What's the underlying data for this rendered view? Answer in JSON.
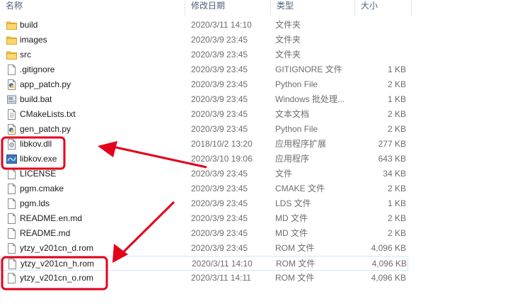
{
  "columns": {
    "name": "名称",
    "date": "修改日期",
    "type": "类型",
    "size": "大小"
  },
  "colors": {
    "annotation": "#e3001b",
    "header_text": "#4c607a",
    "meta_text": "#6d6d6d",
    "folder": "#f7c44b"
  },
  "files": [
    {
      "name": "build",
      "date": "2020/3/11 14:10",
      "type": "文件夹",
      "size": "",
      "icon": "folder-icon"
    },
    {
      "name": "images",
      "date": "2020/3/9 23:45",
      "type": "文件夹",
      "size": "",
      "icon": "folder-icon"
    },
    {
      "name": "src",
      "date": "2020/3/9 23:45",
      "type": "文件夹",
      "size": "",
      "icon": "folder-icon"
    },
    {
      "name": ".gitignore",
      "date": "2020/3/9 23:45",
      "type": "GITIGNORE 文件",
      "size": "1 KB",
      "icon": "file-icon"
    },
    {
      "name": "app_patch.py",
      "date": "2020/3/9 23:45",
      "type": "Python File",
      "size": "2 KB",
      "icon": "python-file-icon"
    },
    {
      "name": "build.bat",
      "date": "2020/3/9 23:45",
      "type": "Windows 批处理...",
      "size": "1 KB",
      "icon": "batch-file-icon"
    },
    {
      "name": "CMakeLists.txt",
      "date": "2020/3/9 23:45",
      "type": "文本文档",
      "size": "2 KB",
      "icon": "text-file-icon"
    },
    {
      "name": "gen_patch.py",
      "date": "2020/3/9 23:45",
      "type": "Python File",
      "size": "2 KB",
      "icon": "python-file-icon"
    },
    {
      "name": "libkov.dll",
      "date": "2018/10/2 13:20",
      "type": "应用程序扩展",
      "size": "277 KB",
      "icon": "dll-file-icon"
    },
    {
      "name": "libkov.exe",
      "date": "2020/3/10 19:06",
      "type": "应用程序",
      "size": "643 KB",
      "icon": "exe-file-icon"
    },
    {
      "name": "LICENSE",
      "date": "2020/3/9 23:45",
      "type": "文件",
      "size": "34 KB",
      "icon": "file-icon"
    },
    {
      "name": "pgm.cmake",
      "date": "2020/3/9 23:45",
      "type": "CMAKE 文件",
      "size": "2 KB",
      "icon": "file-icon"
    },
    {
      "name": "pgm.lds",
      "date": "2020/3/9 23:45",
      "type": "LDS 文件",
      "size": "1 KB",
      "icon": "file-icon"
    },
    {
      "name": "README.en.md",
      "date": "2020/3/9 23:45",
      "type": "MD 文件",
      "size": "2 KB",
      "icon": "file-icon"
    },
    {
      "name": "README.md",
      "date": "2020/3/9 23:45",
      "type": "MD 文件",
      "size": "2 KB",
      "icon": "file-icon"
    },
    {
      "name": "ytzy_v201cn_d.rom",
      "date": "2020/3/9 23:45",
      "type": "ROM 文件",
      "size": "4,096 KB",
      "icon": "file-icon"
    },
    {
      "name": "ytzy_v201cn_h.rom",
      "date": "2020/3/11 14:10",
      "type": "ROM 文件",
      "size": "4,096 KB",
      "icon": "file-icon",
      "selected": true
    },
    {
      "name": "ytzy_v201cn_o.rom",
      "date": "2020/3/11 14:11",
      "type": "ROM 文件",
      "size": "4,096 KB",
      "icon": "file-icon"
    }
  ]
}
